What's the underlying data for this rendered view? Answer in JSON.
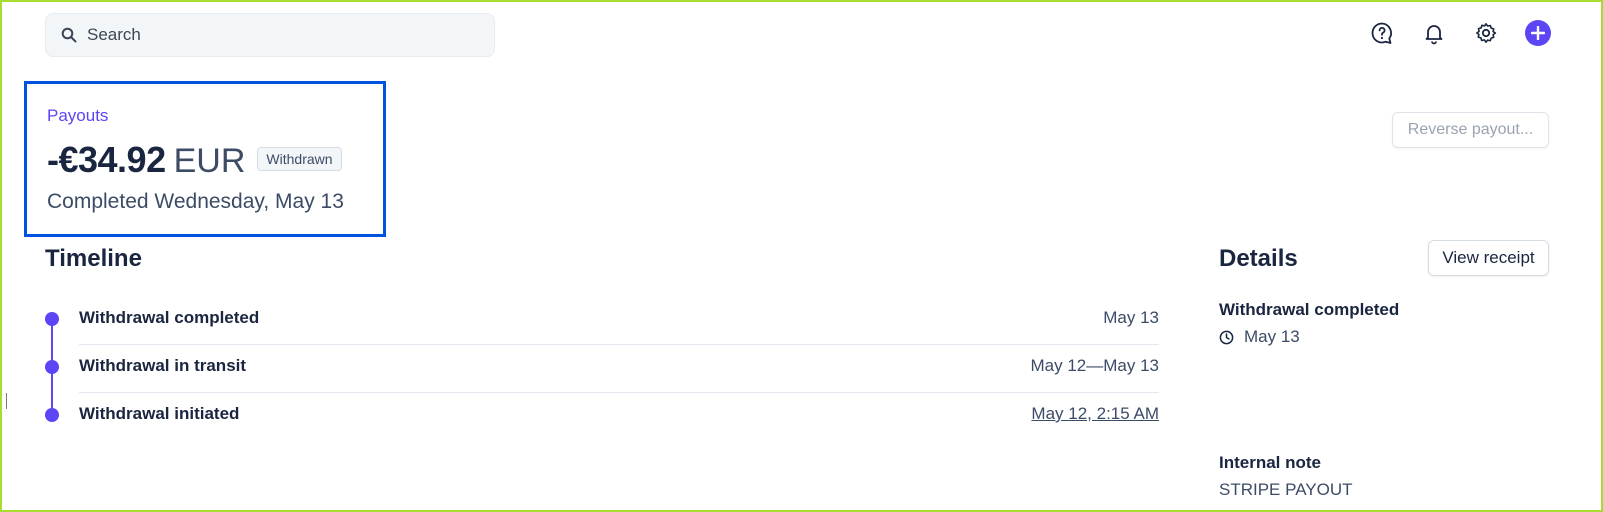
{
  "search": {
    "placeholder": "Search"
  },
  "topbar": {
    "icons": [
      "help-icon",
      "bell-icon",
      "gear-icon",
      "plus-icon"
    ]
  },
  "header": {
    "breadcrumb": "Payouts",
    "amount": "-€34.92",
    "currency": "EUR",
    "status_badge": "Withdrawn",
    "completed_text": "Completed Wednesday, May 13",
    "reverse_button": "Reverse payout..."
  },
  "timeline": {
    "title": "Timeline",
    "events": [
      {
        "label": "Withdrawal completed",
        "date": "May 13"
      },
      {
        "label": "Withdrawal in transit",
        "date": "May 12—May 13"
      },
      {
        "label": "Withdrawal initiated",
        "date": "May 12, 2:15 AM"
      }
    ]
  },
  "details": {
    "title": "Details",
    "view_receipt": "View receipt",
    "withdrawal_label": "Withdrawal completed",
    "withdrawal_date": "May 13",
    "note_label": "Internal note",
    "note_value": "STRIPE PAYOUT"
  },
  "colors": {
    "accent": "#5b45f5",
    "highlight_border": "#0052e0",
    "frame": "#a6dd2e"
  }
}
